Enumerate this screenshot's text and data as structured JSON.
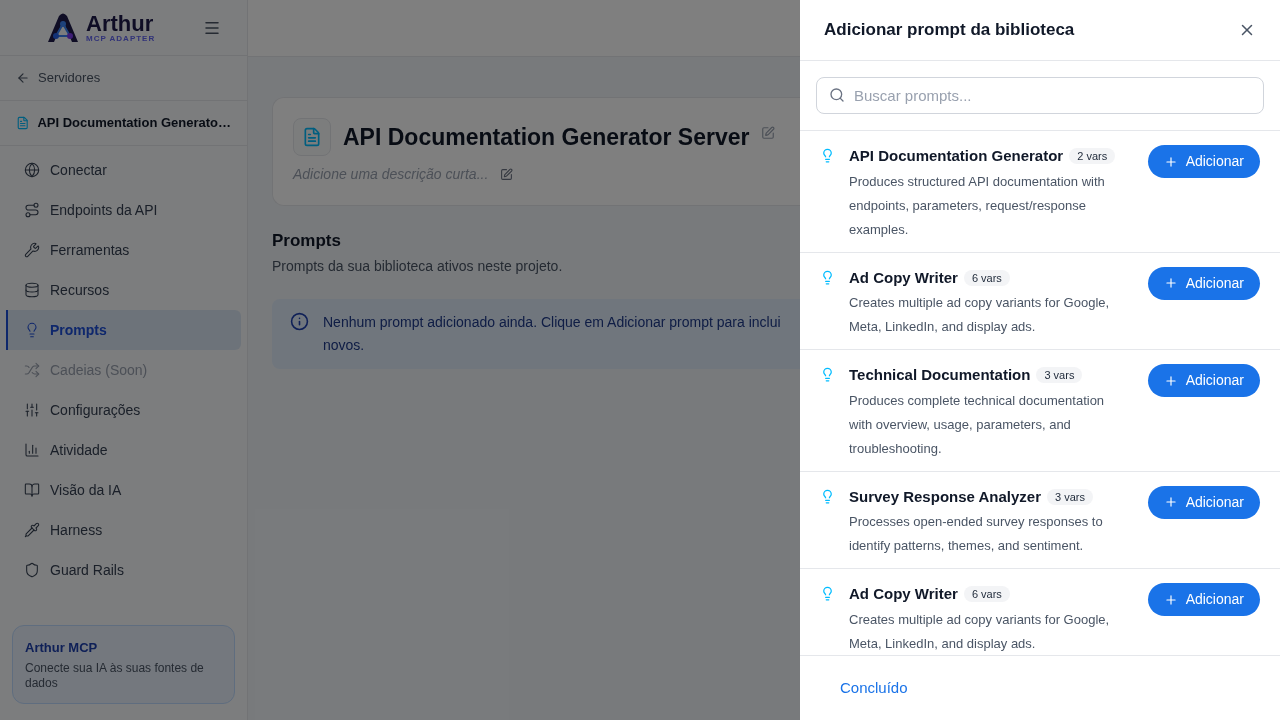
{
  "logo": {
    "name": "Arthur",
    "tagline": "MCP ADAPTER"
  },
  "back_link": "Servidores",
  "server_name": "API Documentation Generato…",
  "nav": [
    {
      "label": "Conectar",
      "selected": false,
      "disabled": false
    },
    {
      "label": "Endpoints da API",
      "selected": false,
      "disabled": false
    },
    {
      "label": "Ferramentas",
      "selected": false,
      "disabled": false
    },
    {
      "label": "Recursos",
      "selected": false,
      "disabled": false
    },
    {
      "label": "Prompts",
      "selected": true,
      "disabled": false
    },
    {
      "label": "Cadeias (Soon)",
      "selected": false,
      "disabled": true
    },
    {
      "label": "Configurações",
      "selected": false,
      "disabled": false
    },
    {
      "label": "Atividade",
      "selected": false,
      "disabled": false
    },
    {
      "label": "Visão da IA",
      "selected": false,
      "disabled": false
    },
    {
      "label": "Harness",
      "selected": false,
      "disabled": false
    },
    {
      "label": "Guard Rails",
      "selected": false,
      "disabled": false
    }
  ],
  "promo": {
    "title": "Arthur MCP",
    "text": "Conecte sua IA às suas fontes de dados"
  },
  "server": {
    "title": "API Documentation Generator Server",
    "description_hint": "Adicione uma descrição curta..."
  },
  "section": {
    "title": "Prompts",
    "subtitle": "Prompts da sua biblioteca ativos neste projeto."
  },
  "notice": {
    "lines": [
      "Nenhum prompt adicionado ainda. Clique em Adicionar prompt para inclui",
      "novos."
    ]
  },
  "drawer": {
    "title": "Adicionar prompt da biblioteca",
    "search": {
      "placeholder": "Buscar prompts..."
    },
    "prompts": [
      {
        "name": "API Documentation Generator",
        "vars": "2 vars",
        "description": "Produces structured API documentation with endpoints, parameters, request/response examples.",
        "button": "Adicionar"
      },
      {
        "name": "Ad Copy Writer",
        "vars": "6 vars",
        "description": "Creates multiple ad copy variants for Google, Meta, LinkedIn, and display ads.",
        "button": "Adicionar"
      },
      {
        "name": "Technical Documentation",
        "vars": "3 vars",
        "description": "Produces complete technical documentation with overview, usage, parameters, and troubleshooting.",
        "button": "Adicionar"
      },
      {
        "name": "Survey Response Analyzer",
        "vars": "3 vars",
        "description": "Processes open-ended survey responses to identify patterns, themes, and sentiment.",
        "button": "Adicionar"
      },
      {
        "name": "Ad Copy Writer",
        "vars": "6 vars",
        "description": "Creates multiple ad copy variants for Google, Meta, LinkedIn, and display ads.",
        "button": "Adicionar"
      }
    ],
    "done": "Concluído"
  }
}
